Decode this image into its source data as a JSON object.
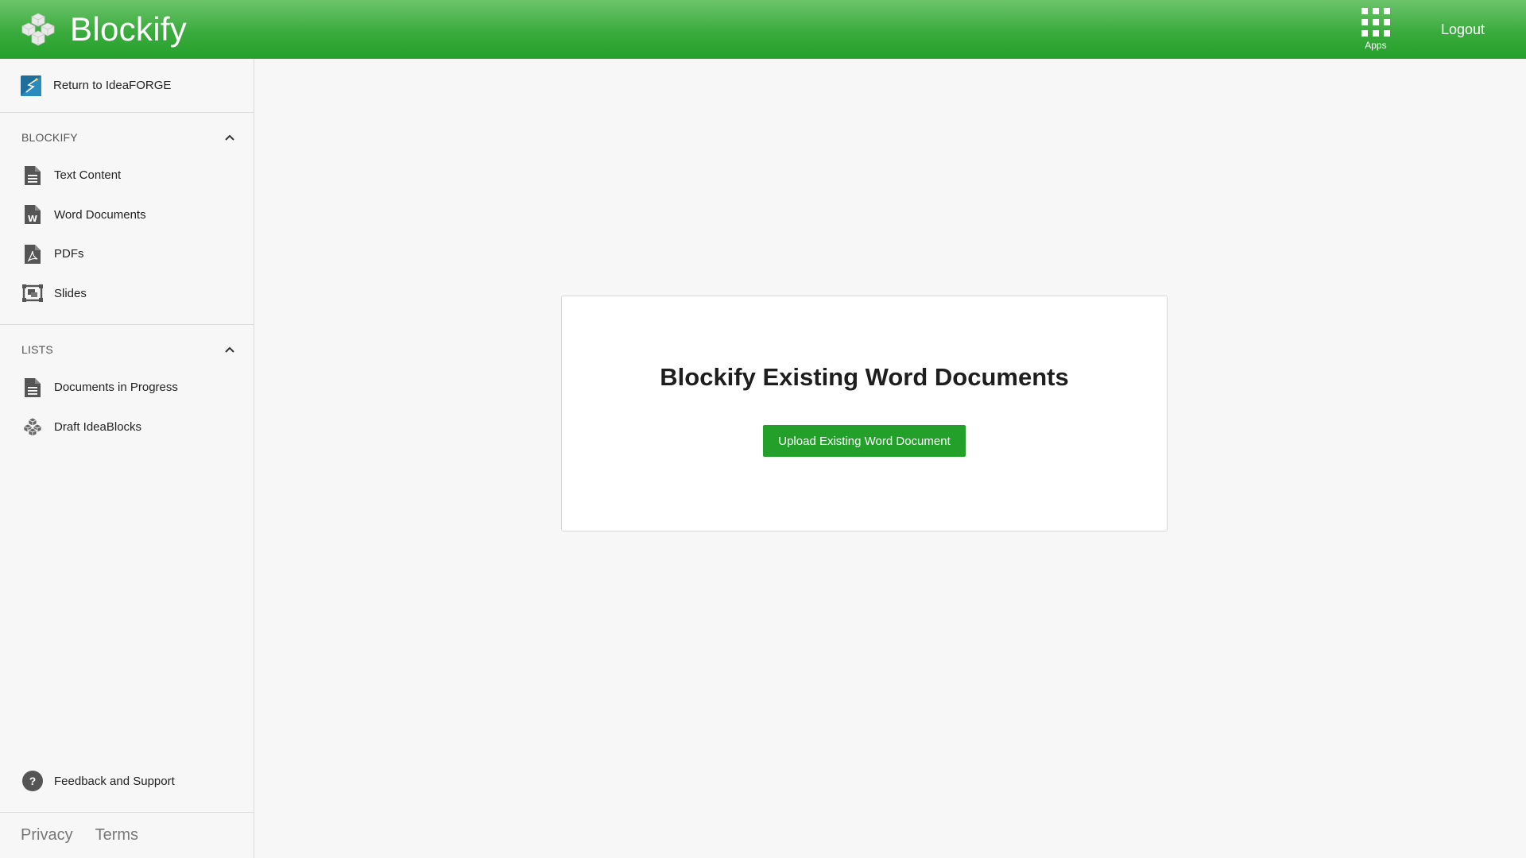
{
  "header": {
    "brand_name": "Blockify",
    "apps_label": "Apps",
    "logout_label": "Logout"
  },
  "sidebar": {
    "return_label": "Return to IdeaFORGE",
    "sections": [
      {
        "title": "BLOCKIFY",
        "items": [
          {
            "label": "Text Content",
            "icon": "document-lines-icon"
          },
          {
            "label": "Word Documents",
            "icon": "word-document-icon"
          },
          {
            "label": "PDFs",
            "icon": "pdf-document-icon"
          },
          {
            "label": "Slides",
            "icon": "slides-icon"
          }
        ]
      },
      {
        "title": "LISTS",
        "items": [
          {
            "label": "Documents in Progress",
            "icon": "document-lines-icon"
          },
          {
            "label": "Draft IdeaBlocks",
            "icon": "blocks-icon"
          }
        ]
      }
    ],
    "feedback_label": "Feedback and Support",
    "feedback_icon_glyph": "?",
    "footer": {
      "privacy_label": "Privacy",
      "terms_label": "Terms"
    }
  },
  "main": {
    "card_title": "Blockify Existing Word Documents",
    "upload_button_label": "Upload Existing Word Document"
  },
  "colors": {
    "header_green": "#3aab3d",
    "button_green": "#23a02a",
    "background": "#f7f7f7"
  }
}
